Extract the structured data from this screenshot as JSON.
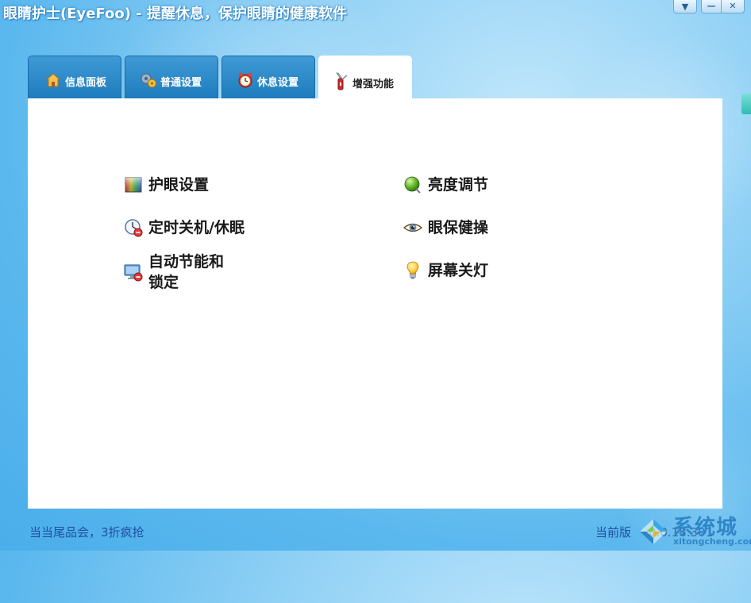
{
  "window": {
    "title": "眼睛护士(EyeFoo) - 提醒休息，保护眼睛的健康软件",
    "buttons": [
      "menu-dropdown",
      "minimize",
      "close"
    ]
  },
  "tabs": [
    {
      "label": "信息面板",
      "icon": "house-icon",
      "active": false
    },
    {
      "label": "普通设置",
      "icon": "gears-icon",
      "active": false
    },
    {
      "label": "休息设置",
      "icon": "alarm-clock-icon",
      "active": false
    },
    {
      "label": "增强功能",
      "icon": "swiss-knife-icon",
      "active": true
    }
  ],
  "features": {
    "eye_settings": {
      "label": "护眼设置",
      "icon": "color-palette-icon"
    },
    "timed_shutdown": {
      "label": "定时关机/休眠",
      "icon": "clock-stop-icon"
    },
    "auto_power_save": {
      "label": "自动节能和锁定",
      "icon": "monitor-stop-icon"
    },
    "brightness": {
      "label": "亮度调节",
      "icon": "green-orb-icon"
    },
    "eye_exercise": {
      "label": "眼保健操",
      "icon": "eye-icon"
    },
    "screen_off": {
      "label": "屏幕关灯",
      "icon": "lightbulb-icon"
    }
  },
  "footer": {
    "promo": "当当尾品会，3折疯抢",
    "version_label": "当前版",
    "version_value": "0.0.18.301"
  },
  "watermark": {
    "text": "系统城",
    "url": "xitongcheng.com"
  },
  "colors": {
    "tab_blue": "#2a88c8",
    "footer_text": "#1f4fa0",
    "background_blue": "#5bb8ee"
  }
}
